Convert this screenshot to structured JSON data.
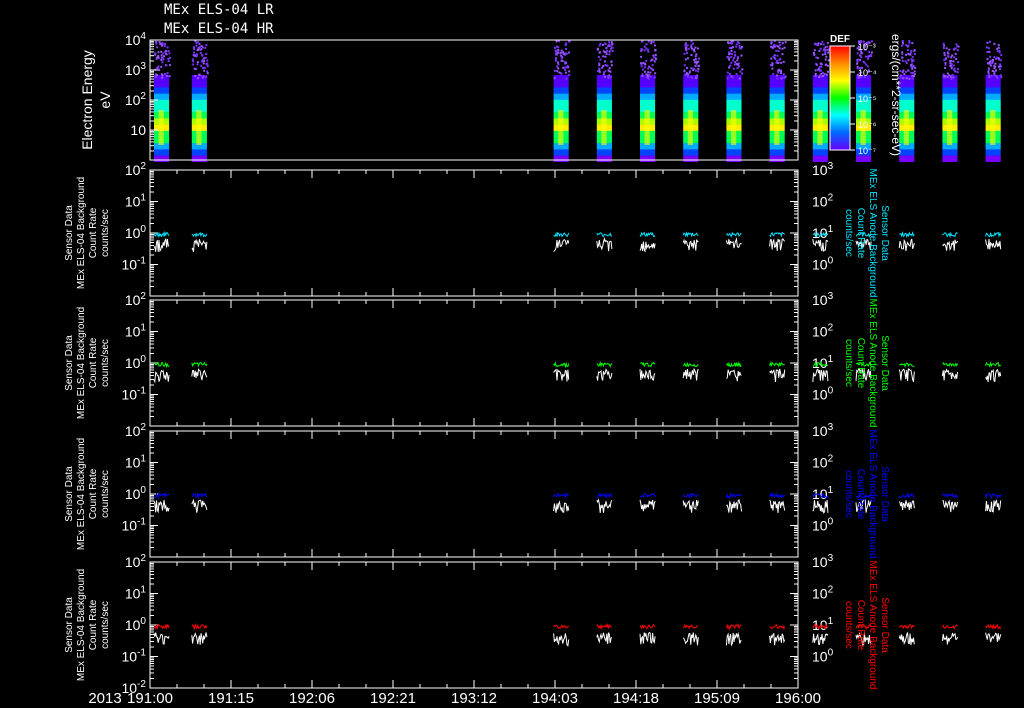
{
  "header": {
    "title_lines": [
      "MEx ELS-04 LR",
      "MEx ELS-04 HR"
    ],
    "year": "2013"
  },
  "colorbar": {
    "label": "DEF",
    "unit": "ergs/(cm**2-sr-sec-eV)",
    "ticks": [
      "10⁻³",
      "10⁻⁴",
      "10⁻⁵",
      "10⁻⁶",
      "10⁻⁷"
    ],
    "colors": [
      "#ff0000",
      "#ff8800",
      "#ffff00",
      "#00ff00",
      "#00ffff",
      "#0066ff",
      "#6600ff"
    ]
  },
  "colors": {
    "background": "#000000",
    "axis": "#ffffff",
    "panel1_series": "#00e5ff",
    "panel2_series": "#00ff00",
    "panel3_series": "#0000ff",
    "panel4_series": "#ff0000",
    "white_series": "#ffffff"
  },
  "chart_data": [
    {
      "type": "heatmap",
      "ylabel": "Electron Energy",
      "yunit": "eV",
      "yscale": "log",
      "ylim": [
        1,
        10000
      ],
      "yticks": [
        {
          "base": "10",
          "exp": "4",
          "value": 10000
        },
        {
          "base": "10",
          "exp": "3",
          "value": 1000
        },
        {
          "base": "10",
          "exp": "2",
          "value": 100
        },
        {
          "base": "10",
          "exp": "",
          "value": 10
        }
      ],
      "xlim": [
        "191:00",
        "196:00"
      ],
      "bursts_start_hours": [
        0,
        7,
        74,
        82,
        90,
        98,
        106,
        114,
        122,
        130,
        138,
        146,
        154
      ],
      "burst_duration_hours": 2.8
    },
    {
      "type": "line",
      "left_axis_label": [
        "Sensor Data",
        "MEx ELS-04 Background",
        "Count Rate",
        "counts/sec"
      ],
      "right_axis_label": [
        "Sensor Data",
        "MEx ELS Anode Background",
        "Count Rate",
        "counts/sec"
      ],
      "yscale": "log",
      "ylim": [
        0.01,
        100
      ],
      "left_ticks": [
        {
          "base": "10",
          "exp": "2"
        },
        {
          "base": "10",
          "exp": "1"
        },
        {
          "base": "10",
          "exp": "0"
        },
        {
          "base": "10",
          "exp": "-1"
        }
      ],
      "right_ticks": [
        {
          "base": "10",
          "exp": "3"
        },
        {
          "base": "10",
          "exp": "2"
        },
        {
          "base": "10",
          "exp": "1"
        },
        {
          "base": "10",
          "exp": "0"
        }
      ],
      "series": [
        {
          "color_key": "panel1_series",
          "level": 0.9
        },
        {
          "color_key": "white_series",
          "level": 0.45
        }
      ]
    },
    {
      "type": "line",
      "left_axis_label": [
        "Sensor Data",
        "MEx ELS-04 Background",
        "Count Rate",
        "counts/sec"
      ],
      "right_axis_label": [
        "Sensor Data",
        "MEx ELS Anode Background",
        "Count Rate",
        "counts/sec"
      ],
      "yscale": "log",
      "ylim": [
        0.01,
        100
      ],
      "left_ticks": [
        {
          "base": "10",
          "exp": "2"
        },
        {
          "base": "10",
          "exp": "1"
        },
        {
          "base": "10",
          "exp": "0"
        },
        {
          "base": "10",
          "exp": "-1"
        }
      ],
      "right_ticks": [
        {
          "base": "10",
          "exp": "3"
        },
        {
          "base": "10",
          "exp": "2"
        },
        {
          "base": "10",
          "exp": "1"
        },
        {
          "base": "10",
          "exp": "0"
        }
      ],
      "series": [
        {
          "color_key": "panel2_series",
          "level": 0.9
        },
        {
          "color_key": "white_series",
          "level": 0.45
        }
      ]
    },
    {
      "type": "line",
      "left_axis_label": [
        "Sensor Data",
        "MEx ELS-04 Background",
        "Count Rate",
        "counts/sec"
      ],
      "right_axis_label": [
        "Sensor Data",
        "MEx ELS Anode Background",
        "Count Rate",
        "counts/sec"
      ],
      "yscale": "log",
      "ylim": [
        0.01,
        100
      ],
      "left_ticks": [
        {
          "base": "10",
          "exp": "2"
        },
        {
          "base": "10",
          "exp": "1"
        },
        {
          "base": "10",
          "exp": "0"
        },
        {
          "base": "10",
          "exp": "-1"
        }
      ],
      "right_ticks": [
        {
          "base": "10",
          "exp": "3"
        },
        {
          "base": "10",
          "exp": "2"
        },
        {
          "base": "10",
          "exp": "1"
        },
        {
          "base": "10",
          "exp": "0"
        }
      ],
      "series": [
        {
          "color_key": "panel3_series",
          "level": 0.9
        },
        {
          "color_key": "white_series",
          "level": 0.45
        }
      ]
    },
    {
      "type": "line",
      "left_axis_label": [
        "Sensor Data",
        "MEx ELS-04 Background",
        "Count Rate",
        "counts/sec"
      ],
      "right_axis_label": [
        "Sensor Data",
        "MEx ELS Anode Background",
        "Count Rate",
        "counts/sec"
      ],
      "yscale": "log",
      "ylim": [
        0.01,
        100
      ],
      "left_ticks": [
        {
          "base": "10",
          "exp": "2"
        },
        {
          "base": "10",
          "exp": "1"
        },
        {
          "base": "10",
          "exp": "0"
        },
        {
          "base": "10",
          "exp": "-1"
        },
        {
          "base": "10",
          "exp": "-2"
        }
      ],
      "right_ticks": [
        {
          "base": "10",
          "exp": "3"
        },
        {
          "base": "10",
          "exp": "2"
        },
        {
          "base": "10",
          "exp": "1"
        },
        {
          "base": "10",
          "exp": "0"
        }
      ],
      "series": [
        {
          "color_key": "panel4_series",
          "level": 0.9
        },
        {
          "color_key": "white_series",
          "level": 0.4
        }
      ]
    }
  ],
  "x_axis": {
    "ticks": [
      "191:00",
      "191:15",
      "192:06",
      "192:21",
      "193:12",
      "194:03",
      "194:18",
      "195:09",
      "196:00"
    ],
    "tick_hours": [
      0,
      15,
      30,
      45,
      60,
      75,
      90,
      105,
      120
    ]
  }
}
